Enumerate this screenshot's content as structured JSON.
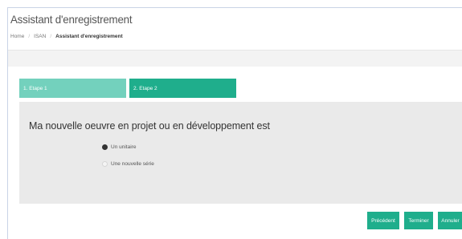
{
  "header": {
    "title": "Assistant d'enregistrement",
    "breadcrumb": {
      "home": "Home",
      "section": "ISAN",
      "current": "Assistant d'enregistrement"
    }
  },
  "wizard": {
    "steps": [
      {
        "label": "1. Etape 1",
        "active": false
      },
      {
        "label": "2. Etape 2",
        "active": true
      }
    ],
    "question": "Ma nouvelle oeuvre en projet ou en développement est",
    "options": [
      {
        "label": "Un unitaire",
        "checked": true
      },
      {
        "label": "Une nouvelle série",
        "checked": false
      }
    ]
  },
  "actions": {
    "previous": "Précédent",
    "finish": "Terminer",
    "cancel": "Annuler"
  },
  "colors": {
    "accent": "#1fae8c",
    "accent_light": "#73d1bd",
    "panel": "#eaeaea",
    "background": "#f3f3f3"
  }
}
